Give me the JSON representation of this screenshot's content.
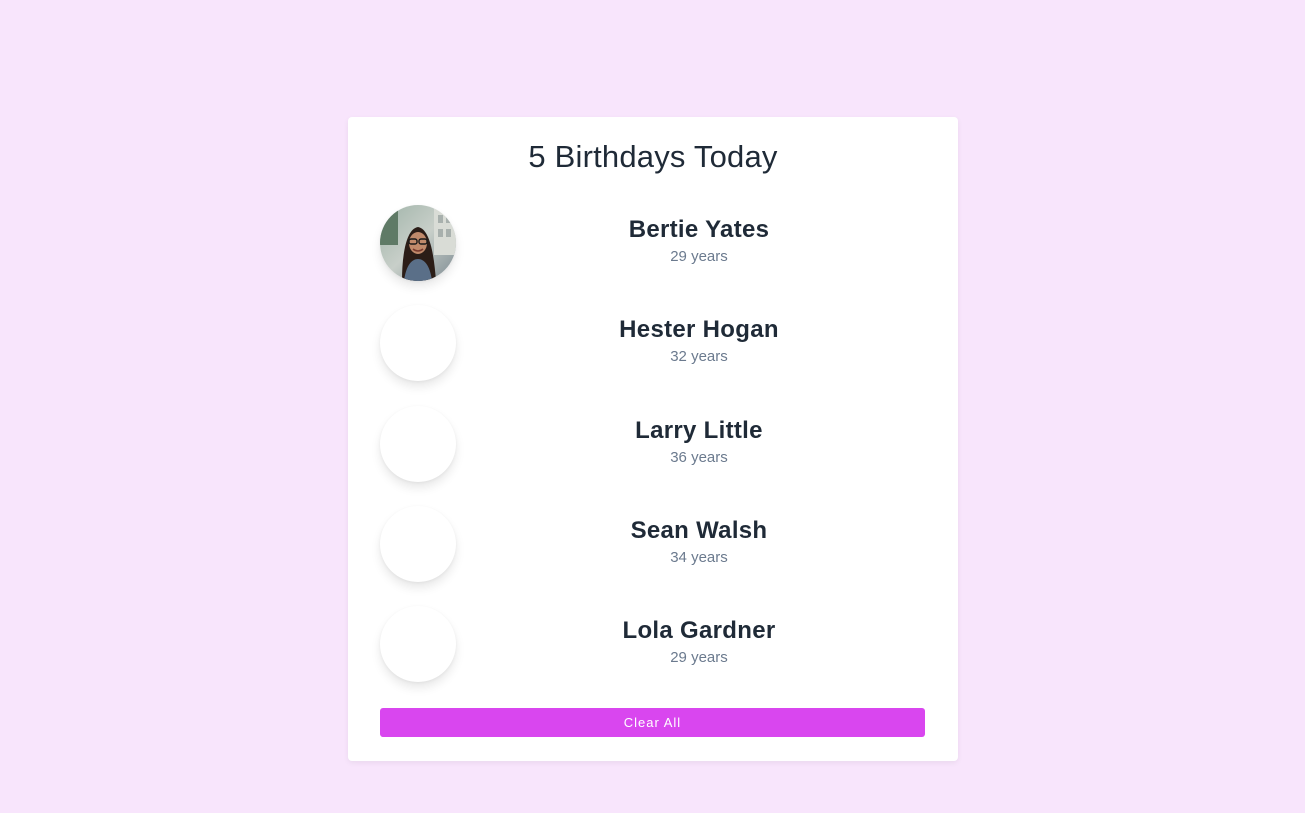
{
  "header": {
    "title": "5 Birthdays Today"
  },
  "people": [
    {
      "name": "Bertie Yates",
      "age": "29 years",
      "avatar": "photo-portrait"
    },
    {
      "name": "Hester Hogan",
      "age": "32 years",
      "avatar": "blank"
    },
    {
      "name": "Larry Little",
      "age": "36 years",
      "avatar": "blank"
    },
    {
      "name": "Sean Walsh",
      "age": "34 years",
      "avatar": "blank"
    },
    {
      "name": "Lola Gardner",
      "age": "29 years",
      "avatar": "blank"
    }
  ],
  "actions": {
    "clear_label": "Clear All"
  },
  "colors": {
    "background": "#f8e5fc",
    "card": "#ffffff",
    "accent": "#d946ef",
    "name_text": "#1f2a37",
    "age_text": "#6b7a8e"
  }
}
